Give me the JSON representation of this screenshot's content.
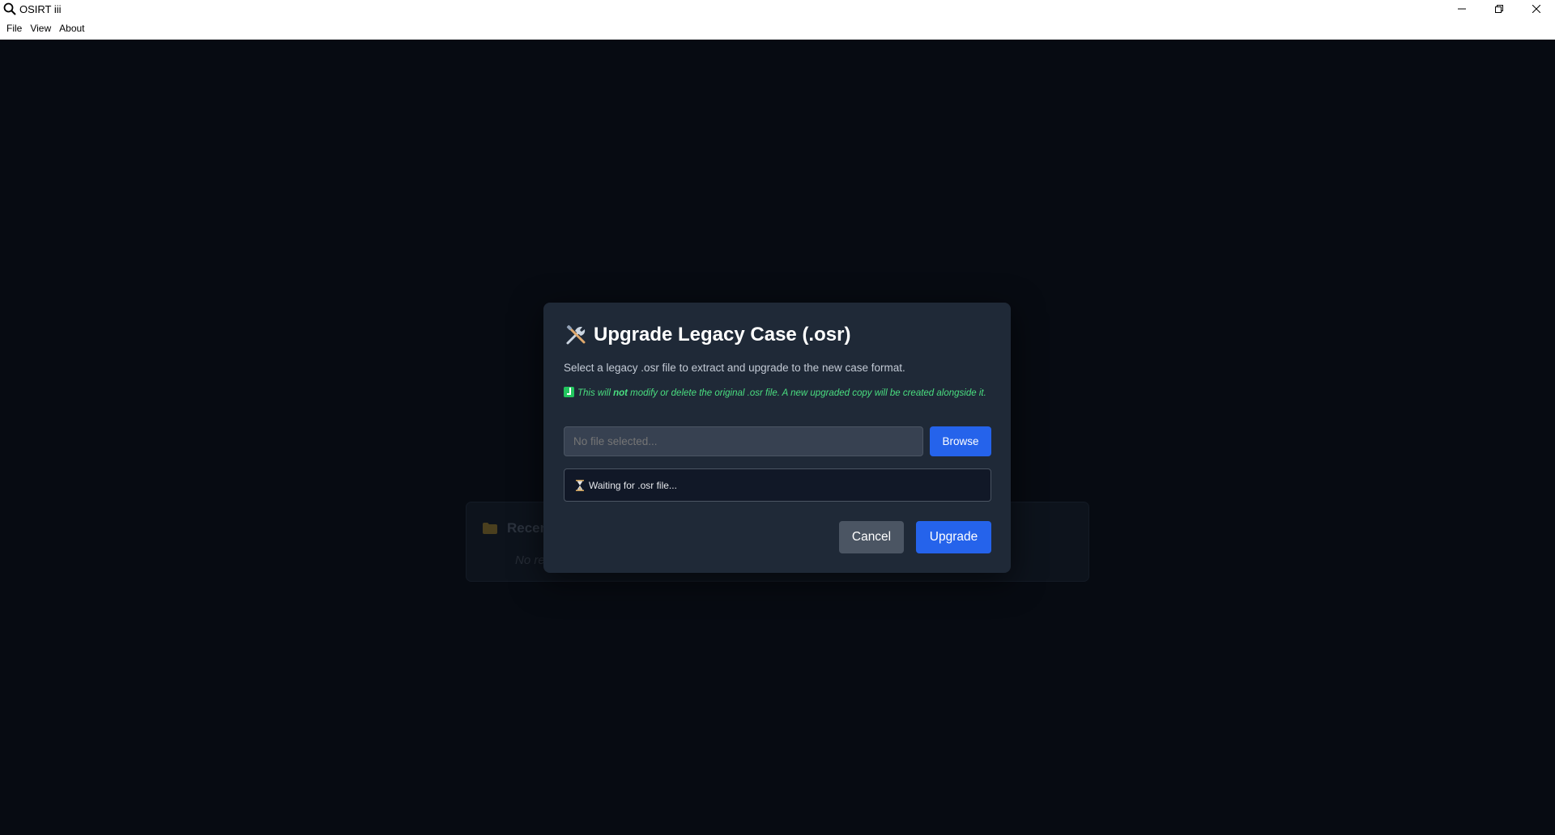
{
  "window": {
    "title": "OSIRT iii",
    "icon": "search-icon",
    "controls": [
      "minimize-icon",
      "restore-icon",
      "close-icon"
    ]
  },
  "menu": {
    "items": [
      "File",
      "View",
      "About"
    ]
  },
  "recent": {
    "title": "Recen",
    "empty_text": "No re",
    "icon": "folder-icon"
  },
  "modal": {
    "title": "Upgrade Legacy Case (.osr)",
    "title_icon": "tools-icon",
    "description": "Select a legacy .osr file to extract and upgrade to the new case format.",
    "note": {
      "pre": "This will ",
      "emphasis": "not",
      "post": " modify or delete the original .osr file. A new upgraded copy will be created alongside it."
    },
    "file_input": {
      "placeholder": "No file selected...",
      "value": ""
    },
    "browse_label": "Browse",
    "status_text": "Waiting for .osr file...",
    "cancel_label": "Cancel",
    "upgrade_label": "Upgrade"
  },
  "colors": {
    "background": "#070b12",
    "modal": "#1f2937",
    "primary": "#2563eb",
    "secondary": "#4b5563",
    "note": "#4ade80"
  }
}
